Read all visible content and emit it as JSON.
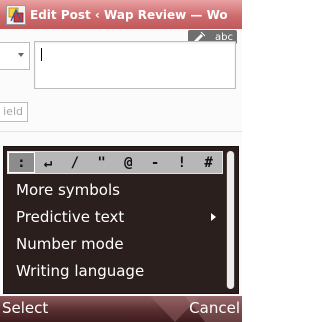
{
  "window": {
    "title": "Edit Post ‹ Wap Review — Wo"
  },
  "input_mode": {
    "label": "abc",
    "icon": "pencil-icon"
  },
  "page": {
    "field_stub_text": "ield",
    "text_field_value": ""
  },
  "symbol_row": [
    ":",
    "↵",
    "/",
    "\"",
    "@",
    "-",
    "!",
    "#"
  ],
  "symbol_selected_index": 0,
  "menu": {
    "items": [
      {
        "label": "More symbols",
        "has_submenu": false
      },
      {
        "label": "Predictive text",
        "has_submenu": true
      },
      {
        "label": "Number mode",
        "has_submenu": false
      },
      {
        "label": "Writing language",
        "has_submenu": false
      }
    ]
  },
  "softkeys": {
    "left": "Select",
    "right": "Cancel"
  },
  "colors": {
    "title_bar": "#cf6b6d",
    "menu_background": "#2b1f1e",
    "symbol_row": "#b7b7b7",
    "softkey_bar": "#5c3133"
  }
}
